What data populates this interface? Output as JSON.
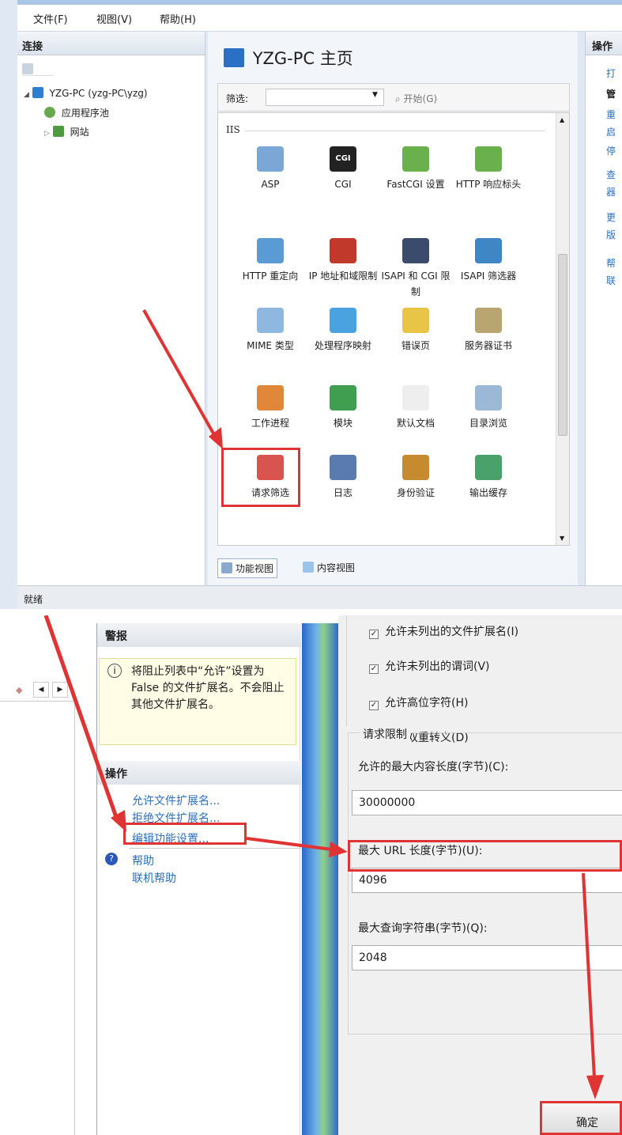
{
  "top": {
    "menu": [
      "文件(F)",
      "视图(V)",
      "帮助(H)"
    ],
    "connections": {
      "header": "连接",
      "tree": [
        "YZG-PC (yzg-PC\\yzg)",
        "应用程序池",
        "网站"
      ]
    },
    "home_title": "YZG-PC 主页",
    "filter": {
      "label": "筛选:",
      "go_label": "开始(G)"
    },
    "group_label": "IIS",
    "features": [
      [
        "ASP",
        "CGI",
        "FastCGI 设置",
        "HTTP 响应标头"
      ],
      [
        "HTTP 重定向",
        "IP 地址和域限制",
        "ISAPI 和 CGI 限制",
        "ISAPI 筛选器"
      ],
      [
        "MIME 类型",
        "处理程序映射",
        "错误页",
        "服务器证书"
      ],
      [
        "工作进程",
        "模块",
        "默认文档",
        "目录浏览"
      ],
      [
        "请求筛选",
        "日志",
        "身份验证",
        "输出缓存"
      ]
    ],
    "cgi_badge": "CGI",
    "views": {
      "feature": "功能视图",
      "content": "内容视图"
    },
    "actions_header": "操作",
    "actions_partial": [
      "打",
      "管",
      "重",
      "启",
      "停",
      "查",
      "器",
      "更",
      "版",
      "帮",
      "联"
    ],
    "status": "就绪"
  },
  "bottom": {
    "alert": {
      "header": "警报",
      "text": "将阻止列表中“允许”设置为 False 的文件扩展名。不会阻止其他文件扩展名。"
    },
    "actions": {
      "header": "操作",
      "links": [
        "允许文件扩展名...",
        "拒绝文件扩展名...",
        "编辑功能设置..."
      ]
    },
    "help": [
      "帮助",
      "联机帮助"
    ],
    "checkboxes": [
      {
        "label": "允许未列出的文件扩展名(I)",
        "checked": true
      },
      {
        "label": "允许未列出的谓词(V)",
        "checked": true
      },
      {
        "label": "允许高位字符(H)",
        "checked": true
      },
      {
        "label": "允许双重转义(D)",
        "checked": false
      }
    ],
    "limits": {
      "header": "请求限制",
      "fields": [
        {
          "label": "允许的最大内容长度(字节)(C):",
          "value": "30000000"
        },
        {
          "label": "最大 URL 长度(字节)(U):",
          "value": "4096"
        },
        {
          "label": "最大查询字符串(字节)(Q):",
          "value": "2048"
        }
      ]
    },
    "ok_label": "确定"
  },
  "colors": {
    "annotation": "#e03434",
    "link": "#2a6fbf"
  }
}
